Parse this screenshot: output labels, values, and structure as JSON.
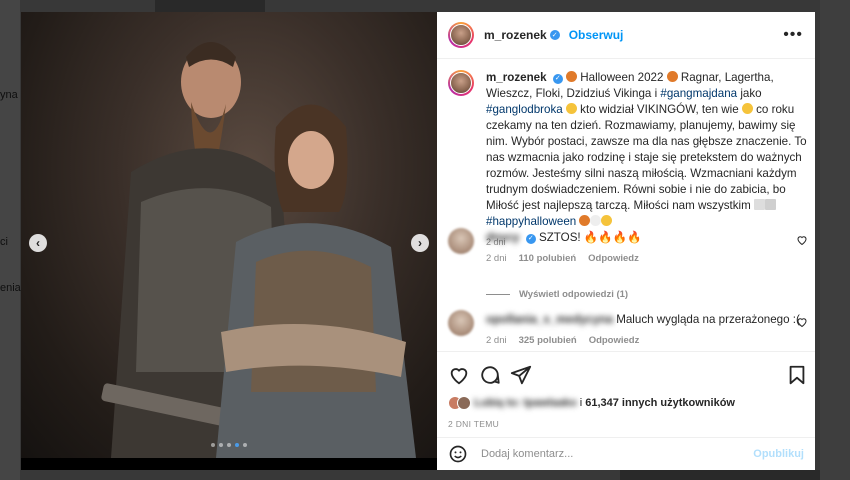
{
  "background": {
    "left_texts": [
      "yna",
      "ci",
      "enia"
    ]
  },
  "post": {
    "username": "m_rozenek",
    "follow_label": "Obserwuj",
    "more_label": "•••",
    "carousel": {
      "prev": "‹",
      "next": "›",
      "slides": 5,
      "active_slide": 4
    }
  },
  "caption": {
    "username": "m_rozenek",
    "segments": [
      {
        "type": "text",
        "value": " Halloween 2022 "
      },
      {
        "type": "text",
        "value": " Ragnar, Lagertha, Wieszcz, Floki, Dzidziuś Vikinga i "
      },
      {
        "type": "tag",
        "value": "#gangmajdana"
      },
      {
        "type": "text",
        "value": " jako "
      },
      {
        "type": "tag",
        "value": "#ganglodbroka"
      },
      {
        "type": "text",
        "value": " kto widział VIKINGÓW, ten wie "
      },
      {
        "type": "text",
        "value": " co roku czekamy na ten dzień. Rozmawiamy, planujemy, bawimy się nim. Wybór postaci, zawsze ma dla nas głębsze znaczenie. To nas wzmacnia jako rodzinę i staje się pretekstem do ważnych rozmów. Jesteśmy silni naszą miłością. Wzmacniani każdym trudnym doświadczeniem. Równi sobie i nie do zabicia, bo Miłość jest najlepszą tarczą. Miłości nam wszystkim "
      },
      {
        "type": "tag",
        "value": "#happyhalloween"
      }
    ],
    "time": "2 dni"
  },
  "comments": [
    {
      "user": "dnycy",
      "text": "SZTOS! 🔥🔥🔥🔥",
      "time": "2 dni",
      "likes": "110 polubień",
      "reply": "Odpowiedz"
    },
    {
      "user": "opollania_s_medycyna",
      "text": "Maluch wygląda na przerażonego :(",
      "time": "2 dni",
      "likes": "325 polubień",
      "reply": "Odpowiedz"
    }
  ],
  "view_replies": "Wyświetl odpowiedzi (1)",
  "likes": {
    "blurred_names": "Lubią to: tpawlaako",
    "and": "i",
    "count_text": "61,347 innych użytkowników"
  },
  "posted_ago": "2 DNI TEMU",
  "add_comment": {
    "placeholder": "Dodaj komentarz...",
    "publish": "Opublikuj"
  },
  "colors": {
    "accent": "#0095f6",
    "tag": "#00376b",
    "muted": "#8e8e8e"
  }
}
